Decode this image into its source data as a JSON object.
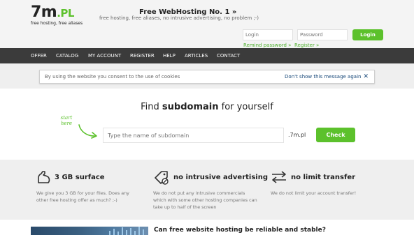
{
  "logo": {
    "main": "7m",
    "dot_pl": ".PL",
    "tagline": "free hosting, free aliases"
  },
  "promo": {
    "title": "Free WebHosting No. 1 »",
    "subtitle": "free hosting, free aliases, no intrusive advertising, no problem ;-)"
  },
  "login": {
    "login_placeholder": "Login",
    "password_placeholder": "Password",
    "button_label": "Login",
    "remind_link": "Remind password »",
    "register_link": "Register »"
  },
  "nav": {
    "items": [
      "OFFER",
      "CATALOG",
      "MY ACCOUNT",
      "REGISTER",
      "HELP",
      "ARTICLES",
      "CONTACT"
    ]
  },
  "cookie": {
    "text": "By using the website you consent to the use of cookies",
    "dismiss": "Don't show this message again"
  },
  "search": {
    "title_prefix": "Find ",
    "title_bold": "subdomain",
    "title_suffix": " for yourself",
    "start_here": "start here",
    "placeholder": "Type the name of subdomain",
    "suffix": ".7m.pl",
    "button_label": "Check"
  },
  "features": [
    {
      "icon": "flexed-arm-icon",
      "title": "3 GB surface",
      "desc": "We give you 3 GB for your files. Does any other free hosting offer as much? ;-)"
    },
    {
      "icon": "no-ads-tag-icon",
      "title": "no intrusive advertising",
      "desc": "We do not put any intrusive commercials which with some other hosting companies can take up to half of the screen"
    },
    {
      "icon": "transfer-arrows-icon",
      "title": "no limit transfer",
      "desc": "We do not limit your account transfer!"
    }
  ],
  "article": {
    "title": "Can free website hosting be reliable and stable?"
  },
  "colors": {
    "accent": "#5cc12c",
    "nav_bg": "#3b3b3b",
    "band_bg": "#efefef"
  }
}
